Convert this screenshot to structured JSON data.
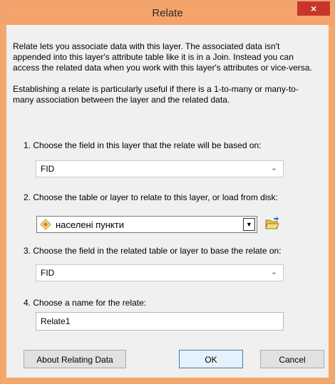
{
  "window": {
    "title": "Relate",
    "close_glyph": "×"
  },
  "description": {
    "para1": "Relate lets you associate data with this layer. The associated data isn't appended into this layer's attribute table like it is in a Join. Instead you can access the related data when you work with this layer's attributes or vice-versa.",
    "para2": "Establishing a relate is particularly useful if there is a 1-to-many or many-to-many association between the layer and the related data."
  },
  "step1": {
    "label": "1. Choose the field in this layer that the relate will be based on:",
    "value": "FID",
    "arrow": "⌄"
  },
  "step2": {
    "label": "2. Choose the table or layer to relate to this layer, or load from disk:",
    "value": "населені пункти",
    "icon": "point-layer-icon",
    "drop": "▼",
    "open_icon": "open-folder-icon"
  },
  "step3": {
    "label": "3. Choose the field in the related table or layer to base the relate on:",
    "value": "FID",
    "arrow": "⌄"
  },
  "step4": {
    "label": "4. Choose a name for the relate:",
    "value": "Relate1"
  },
  "buttons": {
    "about": "About Relating Data",
    "ok": "OK",
    "cancel": "Cancel"
  },
  "colors": {
    "titlebar": "#f4a46a",
    "close": "#c7352b",
    "client": "#f0f0f0"
  }
}
